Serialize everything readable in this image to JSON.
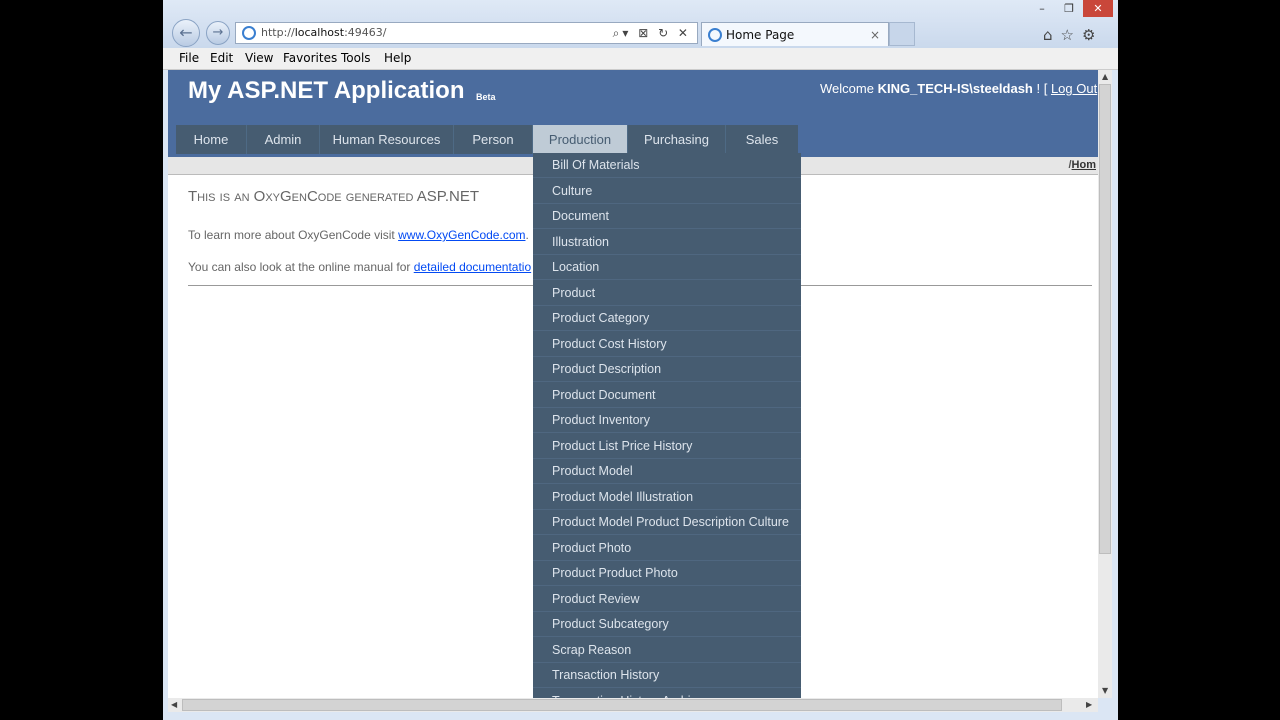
{
  "browser": {
    "url_prefix": "http://",
    "url_host": "localhost",
    "url_rest": ":49463/",
    "tab_title": "Home Page",
    "tab_close": "×",
    "address_tools": "⌕▾ ⊠ ↻ ✕",
    "window_controls": [
      "–",
      "❐",
      "✕"
    ],
    "right_icons": "⌂☆⚙",
    "back_icon": "←",
    "forward_icon": "→",
    "menu": [
      "File",
      "Edit",
      "View",
      "Favorites",
      "Tools",
      "Help"
    ]
  },
  "header": {
    "title": "My ASP.NET Application",
    "beta": "Beta",
    "welcome_prefix": "Welcome ",
    "user": "KING_TECH-IS\\steeldash",
    "bracket": " ! [ ",
    "logout": "Log Out"
  },
  "nav": {
    "items": [
      "Home",
      "Admin",
      "Human Resources",
      "Person",
      "Production",
      "Purchasing",
      "Sales"
    ],
    "active": "Production"
  },
  "breadcrumb": {
    "sep": "/",
    "home": "Hom"
  },
  "content": {
    "heading": "This is an OxyGenCode generated ASP.NET",
    "p1_text": "To learn more about OxyGenCode visit ",
    "p1_link": "www.OxyGenCode.com",
    "p1_end": ".",
    "p2_text": "You can also look at the online manual for ",
    "p2_link": "detailed documentatio"
  },
  "dropdown": {
    "items": [
      "Bill Of Materials",
      "Culture",
      "Document",
      "Illustration",
      "Location",
      "Product",
      "Product Category",
      "Product Cost History",
      "Product Description",
      "Product Document",
      "Product Inventory",
      "Product List Price History",
      "Product Model",
      "Product Model Illustration",
      "Product Model Product Description Culture",
      "Product Photo",
      "Product Product Photo",
      "Product Review",
      "Product Subcategory",
      "Scrap Reason",
      "Transaction History",
      "Transaction History Archive"
    ]
  },
  "colors": {
    "header_bg": "#4b6c9e",
    "nav_bg": "#465c71",
    "nav_active_bg": "#bfcbd6",
    "link": "#034af3"
  }
}
